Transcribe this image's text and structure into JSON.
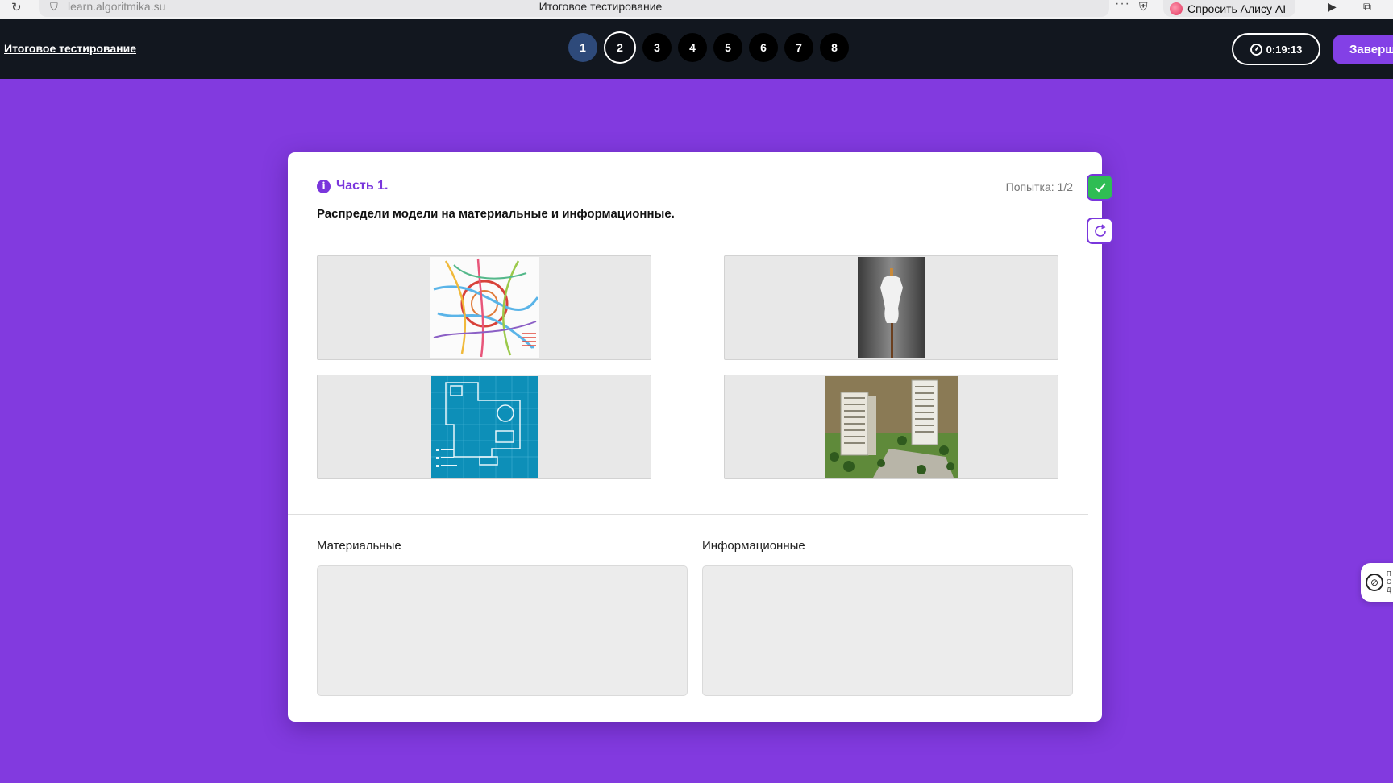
{
  "browser": {
    "url": "learn.algoritmika.su",
    "page_title": "Итоговое тестирование",
    "alice_label": "Спросить Алису AI"
  },
  "header": {
    "title": "Итоговое тестирование",
    "questions": [
      "1",
      "2",
      "3",
      "4",
      "5",
      "6",
      "7",
      "8"
    ],
    "timer": "0:19:13",
    "finish_label": "Заверш"
  },
  "task": {
    "part_label": "Часть 1.",
    "attempt": "Попытка: 1/2",
    "question": "Распредели модели на материальные и информационные.",
    "items": [
      "metro-map",
      "mannequin",
      "floor-plan",
      "building-model"
    ],
    "columns": {
      "material": "Материальные",
      "informational": "Информационные"
    }
  },
  "helper": {
    "text": "П\nС\nД"
  },
  "colors": {
    "background": "#823adf",
    "header": "#12171f",
    "accent": "#7a36dc",
    "check": "#2fbd54"
  }
}
